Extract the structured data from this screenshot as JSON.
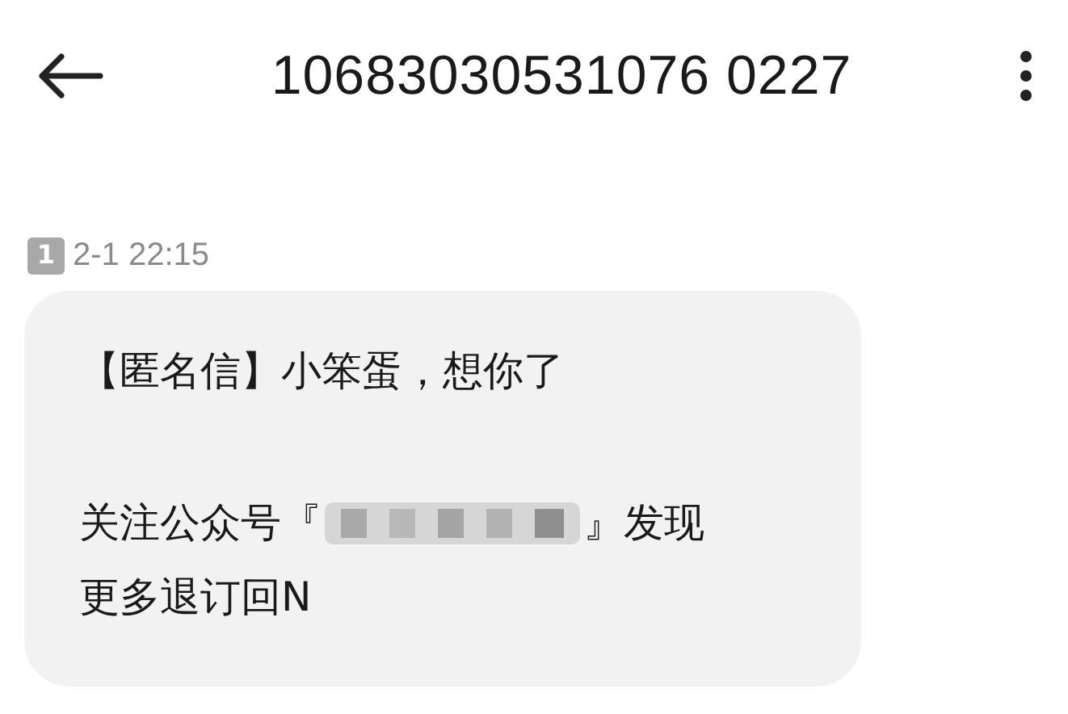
{
  "header": {
    "title": "10683030531076 0227"
  },
  "message": {
    "sim_badge": "1",
    "time": "2-1 22:15",
    "first_line": "【匿名信】小笨蛋，想你了",
    "redacted_line": {
      "before": "关注公众号『",
      "after": "』发现"
    },
    "last_line": "更多退订回N"
  }
}
